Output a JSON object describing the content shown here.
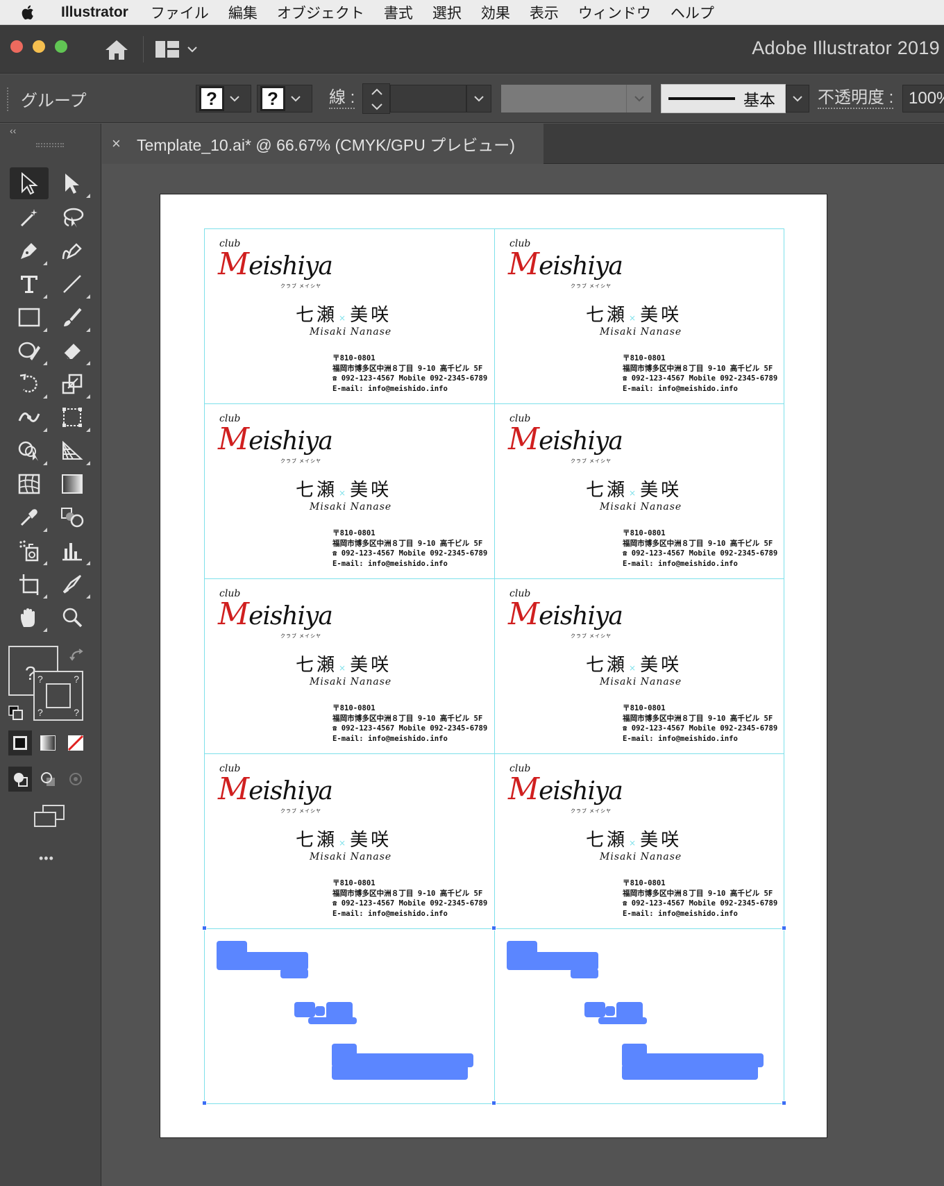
{
  "menubar": {
    "app_name": "Illustrator",
    "items": [
      "ファイル",
      "編集",
      "オブジェクト",
      "書式",
      "選択",
      "効果",
      "表示",
      "ウィンドウ",
      "ヘルプ"
    ]
  },
  "titlebar": {
    "app_title": "Adobe Illustrator 2019"
  },
  "controlbar": {
    "selection_type": "グループ",
    "fill_symbol": "?",
    "stroke_symbol": "?",
    "stroke_label": "線 :",
    "brush_label": "基本",
    "opacity_label": "不透明度 :",
    "opacity_value": "100%"
  },
  "document_tab": {
    "close_symbol": "×",
    "title": "Template_10.ai* @ 66.67% (CMYK/GPU プレビュー)"
  },
  "toolbar": {
    "collapse_symbol": "‹‹",
    "fill_stroke_symbol": "?",
    "more_symbol": "•••"
  },
  "card": {
    "club": "club",
    "logo_initial": "M",
    "logo_rest": "eishiya",
    "kana": "クラブ メイシヤ",
    "name_last": "七瀬",
    "name_sep": "×",
    "name_first": "美咲",
    "roman": "Misaki Nanase",
    "postal": "〒810-0801",
    "address": "福岡市博多区中洲８丁目 9-10 高千ビル 5F",
    "phone": "☎ 092-123-4567  Mobile 092-2345-6789",
    "email": "E-mail: info@meishido.info"
  },
  "colors": {
    "accent_red": "#d01f1f",
    "guide_cyan": "#7de0ea",
    "selection_blue": "#5b86ff"
  }
}
